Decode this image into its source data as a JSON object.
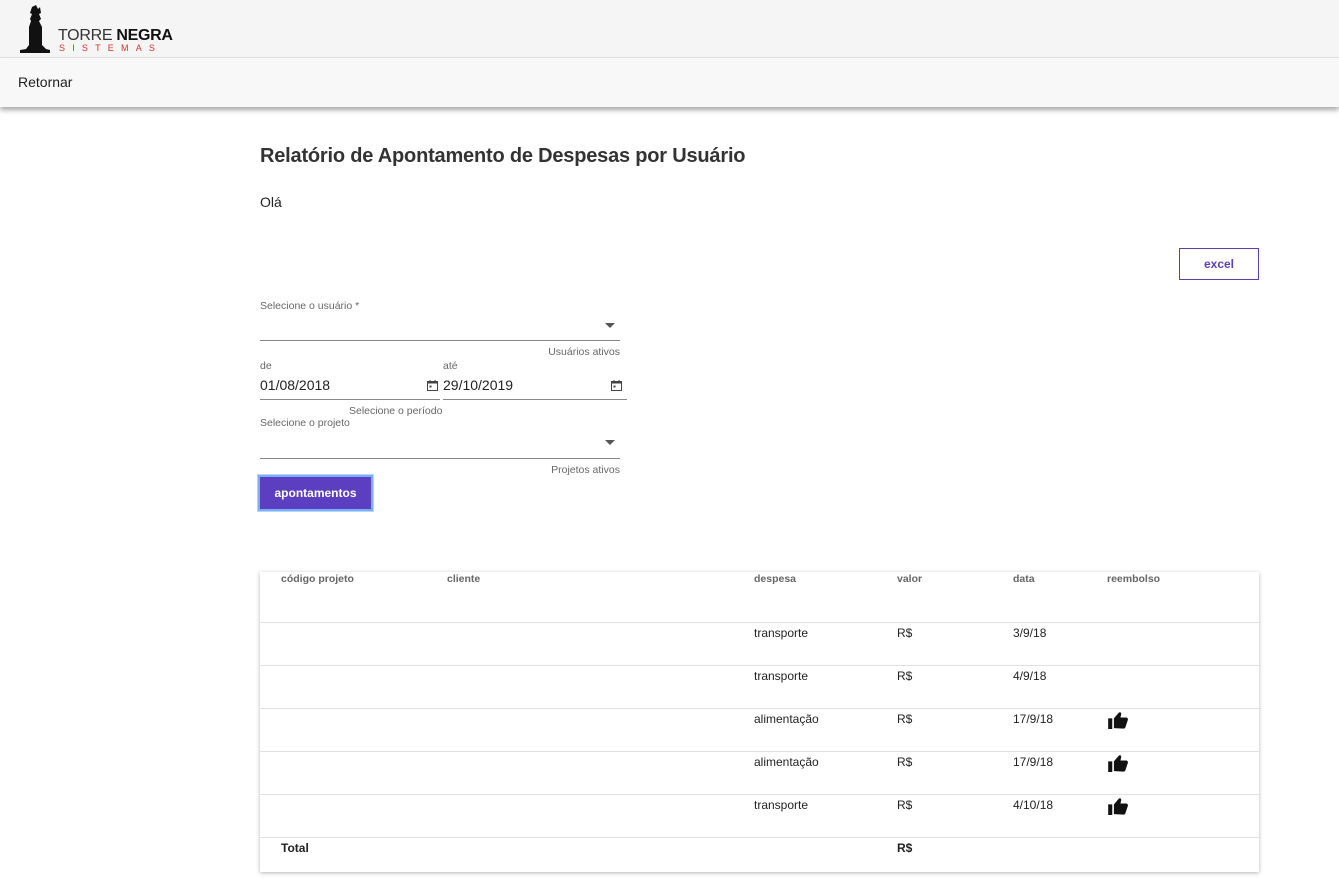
{
  "brand": {
    "name_light": "TORRE",
    "name_bold": "NEGRA",
    "tagline": "SISTEMAS"
  },
  "nav": {
    "back_label": "Retornar"
  },
  "page": {
    "title": "Relatório de Apontamento de Despesas por Usuário",
    "greeting": "Olá"
  },
  "actions": {
    "excel_label": "excel",
    "submit_label": "apontamentos"
  },
  "form": {
    "user": {
      "label": "Selecione o usuário *",
      "value": "",
      "hint": "Usuários ativos"
    },
    "period": {
      "from_label": "de",
      "from_value": "01/08/2018",
      "to_label": "até",
      "to_value": "29/10/2019",
      "hint": "Selecione o período"
    },
    "project": {
      "label": "Selecione o projeto",
      "value": "",
      "hint": "Projetos ativos"
    }
  },
  "colors": {
    "accent": "#5c3fc0",
    "brand_red": "#d6302c"
  },
  "table": {
    "columns": [
      "código projeto",
      "cliente",
      "despesa",
      "valor",
      "data",
      "reembolso"
    ],
    "rows": [
      {
        "codigo": "",
        "cliente": "",
        "despesa": "transporte",
        "valor": "R$",
        "data": "3/9/18",
        "reembolso": ""
      },
      {
        "codigo": "",
        "cliente": "",
        "despesa": "transporte",
        "valor": "R$",
        "data": "4/9/18",
        "reembolso": ""
      },
      {
        "codigo": "",
        "cliente": "",
        "despesa": "alimentação",
        "valor": "R$",
        "data": "17/9/18",
        "reembolso": "thumbs-up-icon"
      },
      {
        "codigo": "",
        "cliente": "",
        "despesa": "alimentação",
        "valor": "R$",
        "data": "17/9/18",
        "reembolso": "thumbs-up-icon"
      },
      {
        "codigo": "",
        "cliente": "",
        "despesa": "transporte",
        "valor": "R$",
        "data": "4/10/18",
        "reembolso": "thumbs-up-icon"
      }
    ],
    "total": {
      "label": "Total",
      "valor": "R$"
    }
  }
}
